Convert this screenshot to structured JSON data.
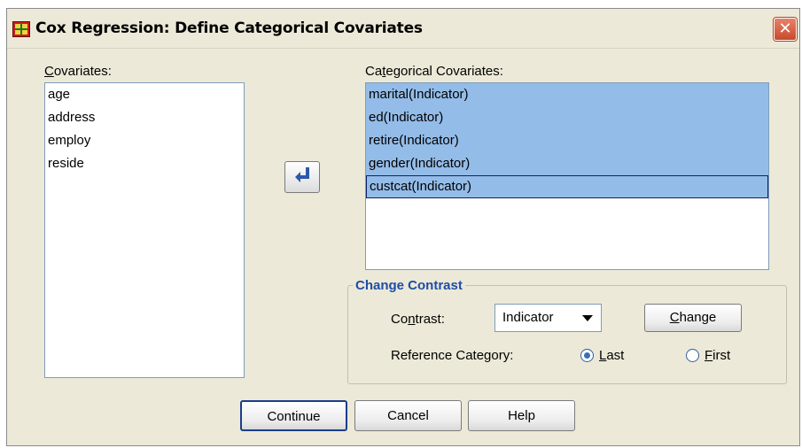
{
  "window": {
    "title": "Cox Regression: Define Categorical Covariates",
    "close_glyph": "✕",
    "app_icon": "spss-table-icon"
  },
  "covariates": {
    "label_mnemonic": "C",
    "label_rest": "ovariates:",
    "items": [
      "age",
      "address",
      "employ",
      "reside"
    ]
  },
  "move_button": {
    "icon": "arrow-left-icon"
  },
  "categorical": {
    "label_pre": "Ca",
    "label_mnemonic": "t",
    "label_rest": "egorical Covariates:",
    "items": [
      "marital(Indicator)",
      "ed(Indicator)",
      "retire(Indicator)",
      "gender(Indicator)",
      "custcat(Indicator)"
    ]
  },
  "change_contrast": {
    "legend": "Change Contrast",
    "contrast_label_pre": "Co",
    "contrast_label_mnemonic": "n",
    "contrast_label_rest": "trast:",
    "contrast_value": "Indicator",
    "change_mnemonic": "C",
    "change_rest": "hange",
    "reference_label": "Reference Category:",
    "last_mnemonic": "L",
    "last_rest": "ast",
    "last_selected": true,
    "first_mnemonic": "F",
    "first_rest": "irst",
    "first_selected": false
  },
  "buttons": {
    "continue": "Continue",
    "cancel": "Cancel",
    "help": "Help"
  },
  "colors": {
    "dialog_bg": "#ece9d8",
    "selection": "#94bce8",
    "group_legend": "#1e4ea8"
  }
}
